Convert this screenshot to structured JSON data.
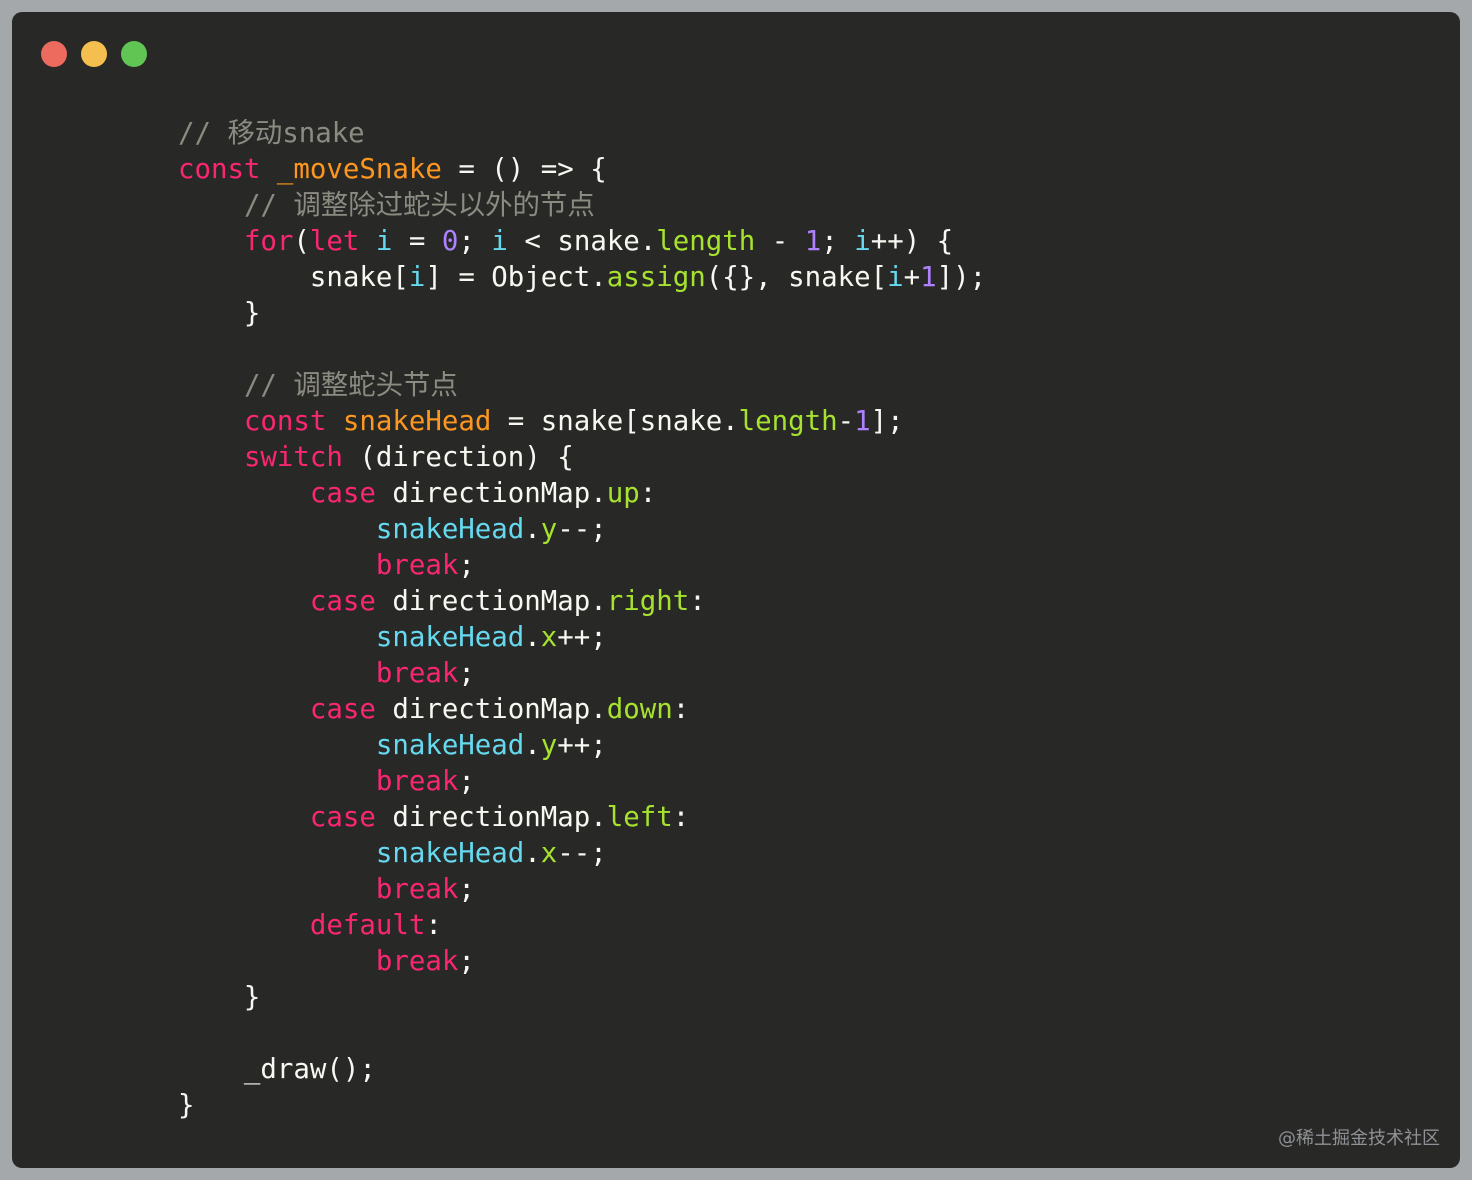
{
  "window": {
    "traffic_lights": [
      {
        "name": "close",
        "color": "#ed6a5e"
      },
      {
        "name": "minimize",
        "color": "#f4bf4f"
      },
      {
        "name": "maximize",
        "color": "#61c554"
      }
    ],
    "background": "#282826"
  },
  "theme": {
    "comment": "#8b8b82",
    "keyword": "#f92672",
    "storage": "#f92672",
    "function": "#fd971f",
    "property": "#a6e22e",
    "number": "#ae81ff",
    "variable": "#66d9ef",
    "text": "#f8f8f2"
  },
  "code": {
    "lines": [
      [
        {
          "t": "    "
        },
        {
          "c": "comment",
          "t": "// 移动snake"
        }
      ],
      [
        {
          "t": "    "
        },
        {
          "c": "keyword",
          "t": "const"
        },
        {
          "t": " "
        },
        {
          "c": "function",
          "t": "_moveSnake"
        },
        {
          "t": " = () => {"
        }
      ],
      [
        {
          "t": "        "
        },
        {
          "c": "comment",
          "t": "// 调整除过蛇头以外的节点"
        }
      ],
      [
        {
          "t": "        "
        },
        {
          "c": "keyword",
          "t": "for"
        },
        {
          "t": "("
        },
        {
          "c": "keyword",
          "t": "let"
        },
        {
          "t": " "
        },
        {
          "c": "variable",
          "t": "i"
        },
        {
          "t": " = "
        },
        {
          "c": "number",
          "t": "0"
        },
        {
          "t": "; "
        },
        {
          "c": "variable",
          "t": "i"
        },
        {
          "t": " < snake."
        },
        {
          "c": "property",
          "t": "length"
        },
        {
          "t": " - "
        },
        {
          "c": "number",
          "t": "1"
        },
        {
          "t": "; "
        },
        {
          "c": "variable",
          "t": "i"
        },
        {
          "t": "++) {"
        }
      ],
      [
        {
          "t": "            snake["
        },
        {
          "c": "variable",
          "t": "i"
        },
        {
          "t": "] = Object."
        },
        {
          "c": "property",
          "t": "assign"
        },
        {
          "t": "({}, snake["
        },
        {
          "c": "variable",
          "t": "i"
        },
        {
          "t": "+"
        },
        {
          "c": "number",
          "t": "1"
        },
        {
          "t": "]);"
        }
      ],
      [
        {
          "t": "        }"
        }
      ],
      [
        {
          "t": ""
        }
      ],
      [
        {
          "t": "        "
        },
        {
          "c": "comment",
          "t": "// 调整蛇头节点"
        }
      ],
      [
        {
          "t": "        "
        },
        {
          "c": "keyword",
          "t": "const"
        },
        {
          "t": " "
        },
        {
          "c": "function",
          "t": "snakeHead"
        },
        {
          "t": " = snake[snake."
        },
        {
          "c": "property",
          "t": "length"
        },
        {
          "t": "-"
        },
        {
          "c": "number",
          "t": "1"
        },
        {
          "t": "];"
        }
      ],
      [
        {
          "t": "        "
        },
        {
          "c": "keyword",
          "t": "switch"
        },
        {
          "t": " (direction) {"
        }
      ],
      [
        {
          "t": "            "
        },
        {
          "c": "keyword",
          "t": "case"
        },
        {
          "t": " directionMap."
        },
        {
          "c": "property",
          "t": "up"
        },
        {
          "t": ":"
        }
      ],
      [
        {
          "t": "                "
        },
        {
          "c": "variable",
          "t": "snakeHead"
        },
        {
          "t": "."
        },
        {
          "c": "property",
          "t": "y"
        },
        {
          "t": "--;"
        }
      ],
      [
        {
          "t": "                "
        },
        {
          "c": "keyword",
          "t": "break"
        },
        {
          "t": ";"
        }
      ],
      [
        {
          "t": "            "
        },
        {
          "c": "keyword",
          "t": "case"
        },
        {
          "t": " directionMap."
        },
        {
          "c": "property",
          "t": "right"
        },
        {
          "t": ":"
        }
      ],
      [
        {
          "t": "                "
        },
        {
          "c": "variable",
          "t": "snakeHead"
        },
        {
          "t": "."
        },
        {
          "c": "property",
          "t": "x"
        },
        {
          "t": "++;"
        }
      ],
      [
        {
          "t": "                "
        },
        {
          "c": "keyword",
          "t": "break"
        },
        {
          "t": ";"
        }
      ],
      [
        {
          "t": "            "
        },
        {
          "c": "keyword",
          "t": "case"
        },
        {
          "t": " directionMap."
        },
        {
          "c": "property",
          "t": "down"
        },
        {
          "t": ":"
        }
      ],
      [
        {
          "t": "                "
        },
        {
          "c": "variable",
          "t": "snakeHead"
        },
        {
          "t": "."
        },
        {
          "c": "property",
          "t": "y"
        },
        {
          "t": "++;"
        }
      ],
      [
        {
          "t": "                "
        },
        {
          "c": "keyword",
          "t": "break"
        },
        {
          "t": ";"
        }
      ],
      [
        {
          "t": "            "
        },
        {
          "c": "keyword",
          "t": "case"
        },
        {
          "t": " directionMap."
        },
        {
          "c": "property",
          "t": "left"
        },
        {
          "t": ":"
        }
      ],
      [
        {
          "t": "                "
        },
        {
          "c": "variable",
          "t": "snakeHead"
        },
        {
          "t": "."
        },
        {
          "c": "property",
          "t": "x"
        },
        {
          "t": "--;"
        }
      ],
      [
        {
          "t": "                "
        },
        {
          "c": "keyword",
          "t": "break"
        },
        {
          "t": ";"
        }
      ],
      [
        {
          "t": "            "
        },
        {
          "c": "keyword",
          "t": "default"
        },
        {
          "t": ":"
        }
      ],
      [
        {
          "t": "                "
        },
        {
          "c": "keyword",
          "t": "break"
        },
        {
          "t": ";"
        }
      ],
      [
        {
          "t": "        }"
        }
      ],
      [
        {
          "t": ""
        }
      ],
      [
        {
          "t": "        _draw();"
        }
      ],
      [
        {
          "t": "    }"
        }
      ]
    ]
  },
  "watermark": "@稀土掘金技术社区"
}
